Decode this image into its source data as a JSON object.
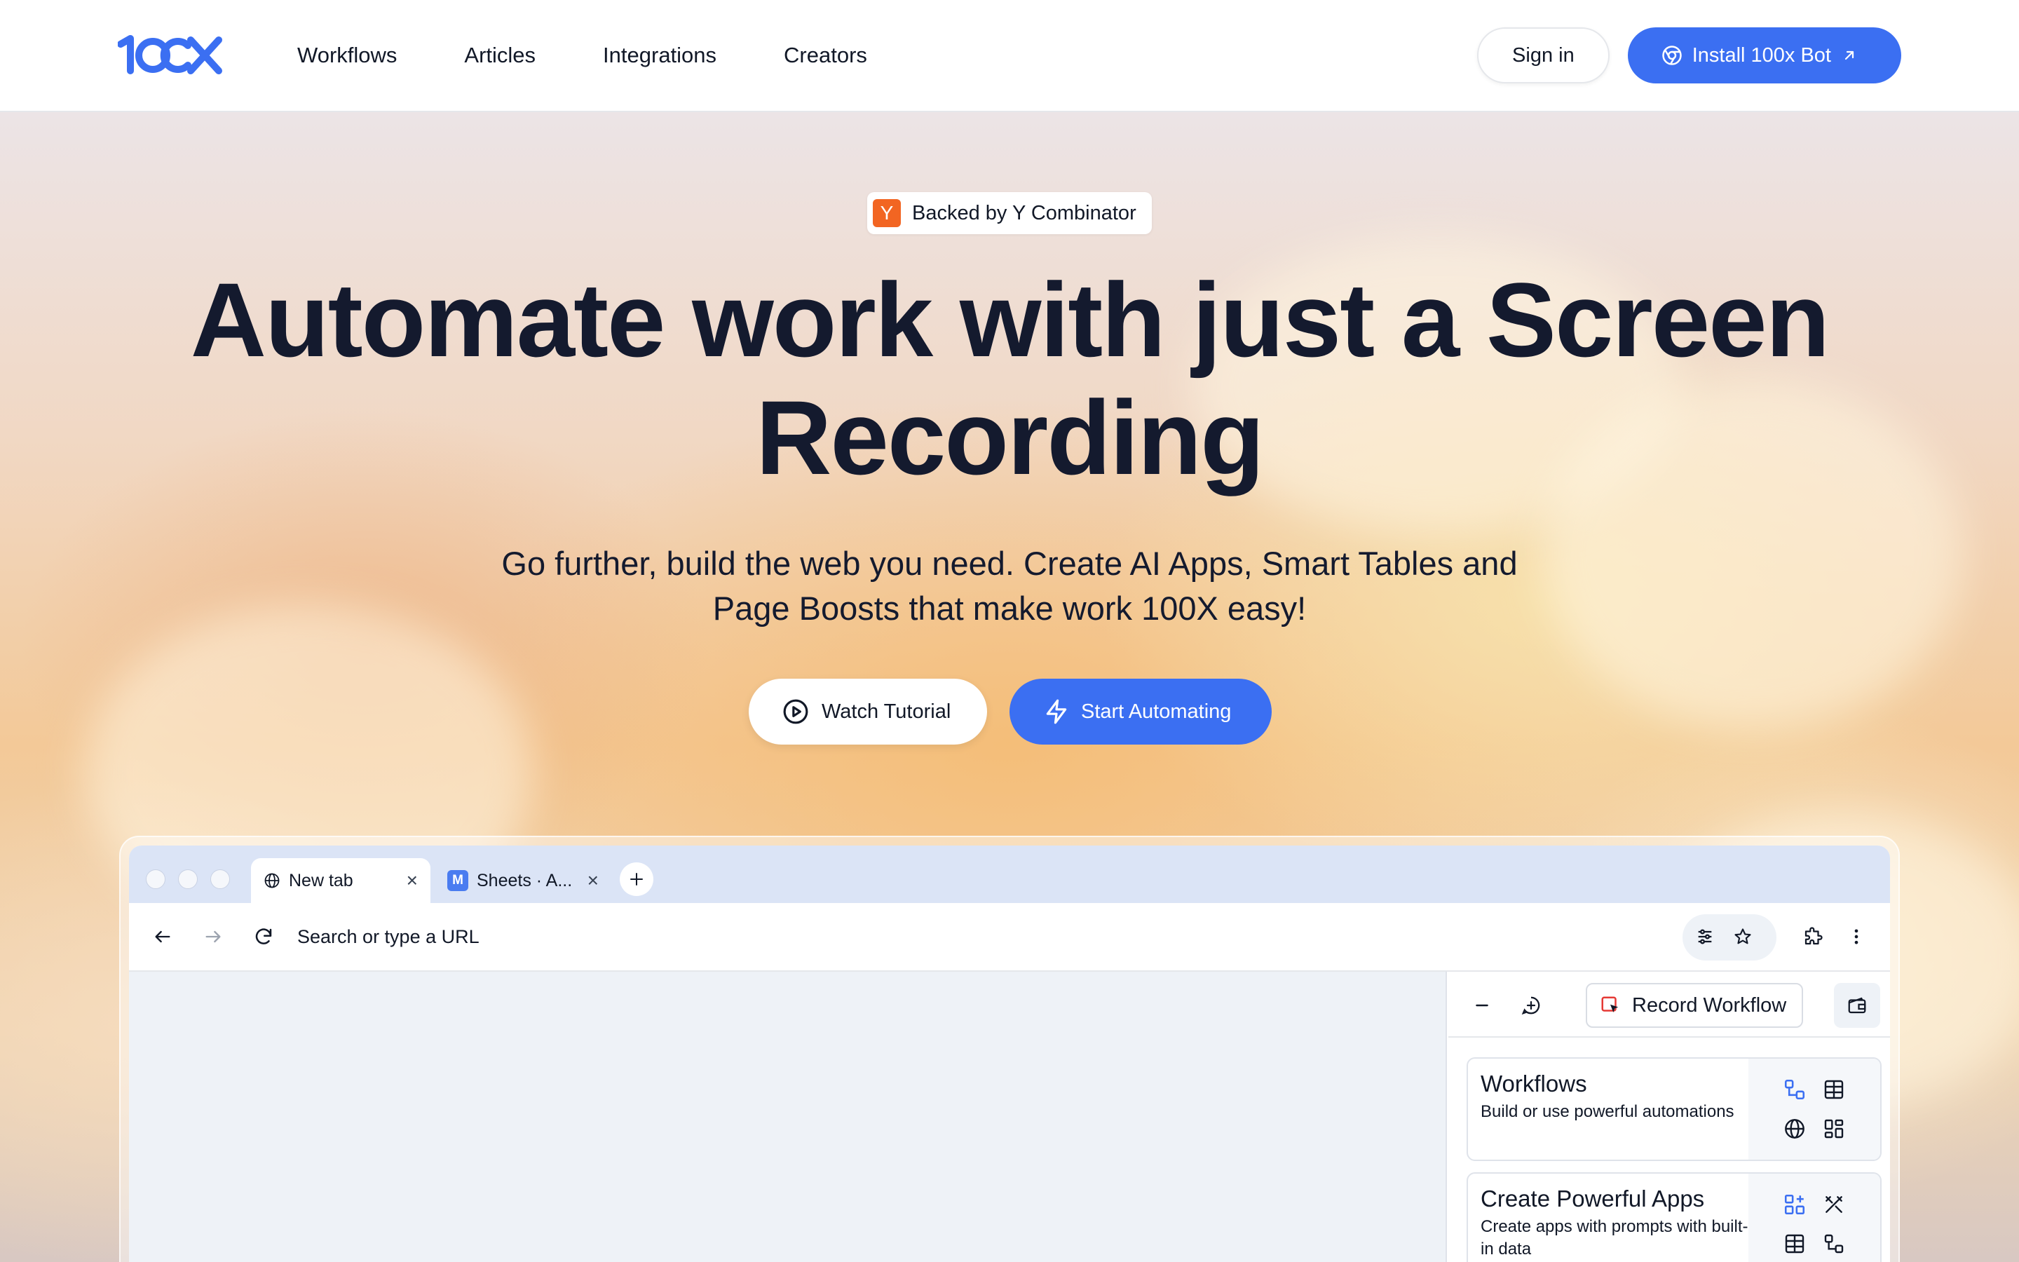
{
  "header": {
    "logo_text": "100X",
    "nav": [
      "Workflows",
      "Articles",
      "Integrations",
      "Creators"
    ],
    "sign_in_label": "Sign in",
    "install_label": "Install 100x Bot"
  },
  "hero": {
    "badge_letter": "Y",
    "badge_text": "Backed by Y Combinator",
    "headline_line1": "Automate work with just a Screen",
    "headline_line2": "Recording",
    "subhead_line1": "Go further, build the web you need. Create AI Apps, Smart Tables and",
    "subhead_line2": "Page Boosts that make work 100X easy!",
    "watch_label": "Watch Tutorial",
    "start_label": "Start Automating"
  },
  "browser": {
    "tabs": [
      {
        "title": "New tab",
        "icon": "globe-icon"
      },
      {
        "title": "Sheets · A...",
        "icon_letter": "M"
      }
    ],
    "url_placeholder": "Search or type a URL",
    "panel": {
      "record_label": "Record Workflow",
      "cards": [
        {
          "title": "Workflows",
          "desc": "Build or use powerful automations"
        },
        {
          "title": "Create Powerful Apps",
          "desc": "Create apps with prompts with built-in data"
        }
      ]
    }
  },
  "colors": {
    "accent": "#3b6ff2",
    "yc_orange": "#f26522",
    "text_dark": "#141a2e"
  }
}
